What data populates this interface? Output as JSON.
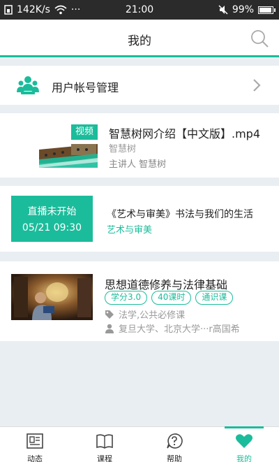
{
  "status_bar": {
    "speed": "142K/s",
    "more": "···",
    "time": "21:00",
    "battery": "99%"
  },
  "header": {
    "title": "我的"
  },
  "account": {
    "label": "用户帐号管理"
  },
  "video": {
    "tag": "视频",
    "title": "智慧树网介绍【中文版】.mp4",
    "source": "智慧树",
    "speaker": "主讲人 智慧树"
  },
  "live": {
    "status": "直播未开始",
    "datetime": "05/21 09:30",
    "title": "《艺术与审美》书法与我们的生活",
    "course": "艺术与审美"
  },
  "course": {
    "title": "思想道德修养与法律基础",
    "tags": [
      "学分3.0",
      "40课时",
      "通识课"
    ],
    "category": "法学,公共必修课",
    "schools": "复旦大学、北京大学···r高国希"
  },
  "tabs": [
    {
      "label": "动态",
      "icon": "news-icon"
    },
    {
      "label": "课程",
      "icon": "book-icon"
    },
    {
      "label": "帮助",
      "icon": "help-icon"
    },
    {
      "label": "我的",
      "icon": "heart-icon",
      "active": true
    }
  ],
  "colors": {
    "accent": "#1bbc9b",
    "status_bar": "#2b2b2b",
    "background": "#e9eef2"
  }
}
